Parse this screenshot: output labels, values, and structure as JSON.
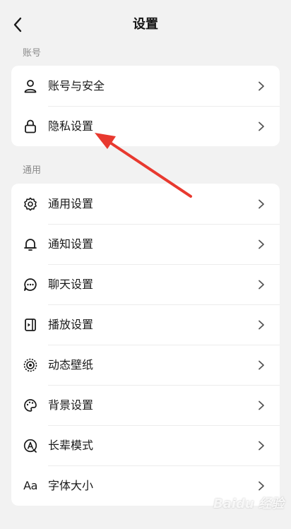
{
  "header": {
    "title": "设置"
  },
  "sections": [
    {
      "label": "账号",
      "items": [
        {
          "label": "账号与安全",
          "icon": "user-icon"
        },
        {
          "label": "隐私设置",
          "icon": "lock-icon"
        }
      ]
    },
    {
      "label": "通用",
      "items": [
        {
          "label": "通用设置",
          "icon": "gear-icon"
        },
        {
          "label": "通知设置",
          "icon": "bell-icon"
        },
        {
          "label": "聊天设置",
          "icon": "chat-bubble-icon"
        },
        {
          "label": "播放设置",
          "icon": "play-settings-icon"
        },
        {
          "label": "动态壁纸",
          "icon": "dynamic-wallpaper-icon"
        },
        {
          "label": "背景设置",
          "icon": "palette-icon"
        },
        {
          "label": "长辈模式",
          "icon": "elder-mode-icon"
        },
        {
          "label": "字体大小",
          "icon": "font-size-icon",
          "glyph": "Aa"
        }
      ]
    }
  ],
  "annotation": {
    "arrow_color": "#e8392f",
    "points_to": "隐私设置"
  },
  "watermark": "Baidu 经验"
}
